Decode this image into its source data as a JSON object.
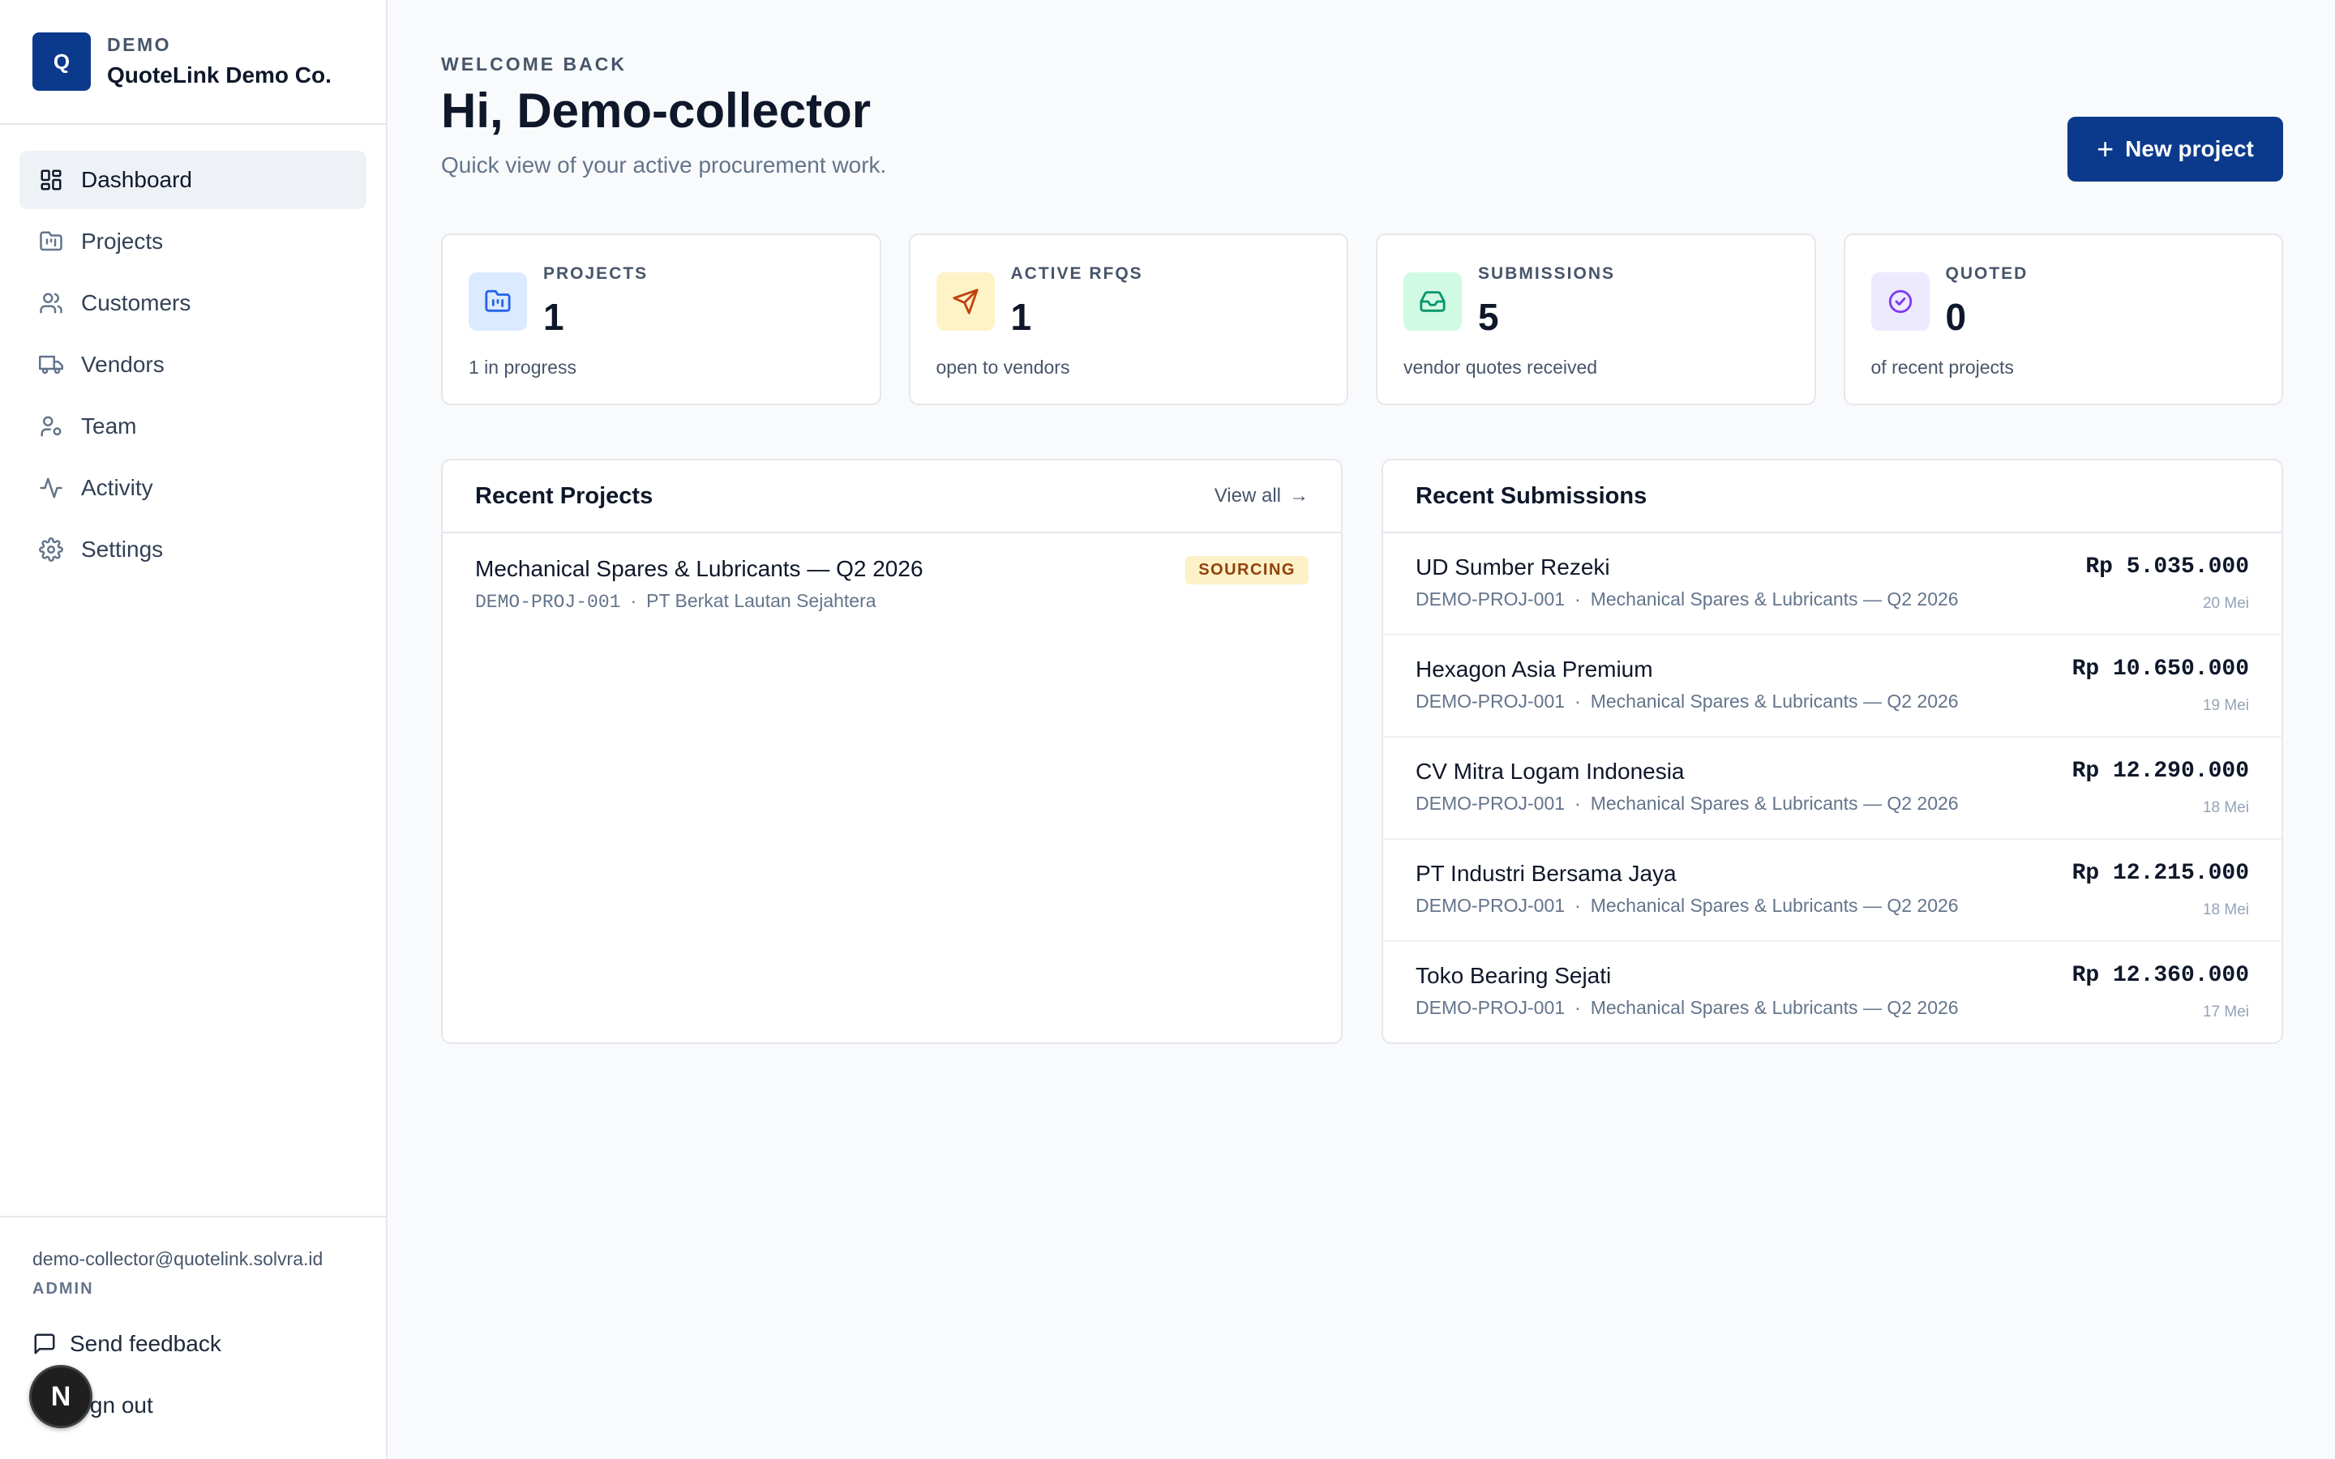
{
  "brand": {
    "logo_letter": "Q",
    "org_tag": "DEMO",
    "name": "QuoteLink Demo Co."
  },
  "nav": {
    "items": [
      {
        "label": "Dashboard",
        "icon": "dashboard-icon",
        "active": true
      },
      {
        "label": "Projects",
        "icon": "folder-icon"
      },
      {
        "label": "Customers",
        "icon": "users-icon"
      },
      {
        "label": "Vendors",
        "icon": "truck-icon"
      },
      {
        "label": "Team",
        "icon": "team-icon"
      },
      {
        "label": "Activity",
        "icon": "activity-icon"
      },
      {
        "label": "Settings",
        "icon": "gear-icon"
      }
    ]
  },
  "user": {
    "email": "demo-collector@quotelink.solvra.id",
    "role": "ADMIN",
    "feedback_label": "Send feedback",
    "signout_label": "Sign out",
    "dev_badge": "N"
  },
  "header": {
    "eyebrow": "WELCOME BACK",
    "title": "Hi, Demo-collector",
    "subtitle": "Quick view of your active procurement work.",
    "new_project_label": "New project"
  },
  "stats": [
    {
      "label": "PROJECTS",
      "value": "1",
      "caption": "1 in progress",
      "icon": "folder-chart-icon",
      "color": "#2563eb",
      "bg": "#dbeafe"
    },
    {
      "label": "ACTIVE RFQS",
      "value": "1",
      "caption": "open to vendors",
      "icon": "send-icon",
      "color": "#c2410c",
      "bg": "#fef3c7"
    },
    {
      "label": "SUBMISSIONS",
      "value": "5",
      "caption": "vendor quotes received",
      "icon": "inbox-icon",
      "color": "#059669",
      "bg": "#d1fae5"
    },
    {
      "label": "QUOTED",
      "value": "0",
      "caption": "of recent projects",
      "icon": "check-circle-icon",
      "color": "#7c3aed",
      "bg": "#ede9fe"
    }
  ],
  "recent_projects": {
    "title": "Recent Projects",
    "view_all_label": "View all",
    "items": [
      {
        "name": "Mechanical Spares & Lubricants — Q2 2026",
        "code": "DEMO-PROJ-001",
        "customer": "PT Berkat Lautan Sejahtera",
        "status": "SOURCING"
      }
    ]
  },
  "recent_submissions": {
    "title": "Recent Submissions",
    "items": [
      {
        "vendor": "UD Sumber Rezeki",
        "code": "DEMO-PROJ-001",
        "project": "Mechanical Spares & Lubricants — Q2 2026",
        "amount": "Rp 5.035.000",
        "date": "20 Mei"
      },
      {
        "vendor": "Hexagon Asia Premium",
        "code": "DEMO-PROJ-001",
        "project": "Mechanical Spares & Lubricants — Q2 2026",
        "amount": "Rp 10.650.000",
        "date": "19 Mei"
      },
      {
        "vendor": "CV Mitra Logam Indonesia",
        "code": "DEMO-PROJ-001",
        "project": "Mechanical Spares & Lubricants — Q2 2026",
        "amount": "Rp 12.290.000",
        "date": "18 Mei"
      },
      {
        "vendor": "PT Industri Bersama Jaya",
        "code": "DEMO-PROJ-001",
        "project": "Mechanical Spares & Lubricants — Q2 2026",
        "amount": "Rp 12.215.000",
        "date": "18 Mei"
      },
      {
        "vendor": "Toko Bearing Sejati",
        "code": "DEMO-PROJ-001",
        "project": "Mechanical Spares & Lubricants — Q2 2026",
        "amount": "Rp 12.360.000",
        "date": "17 Mei"
      }
    ]
  }
}
